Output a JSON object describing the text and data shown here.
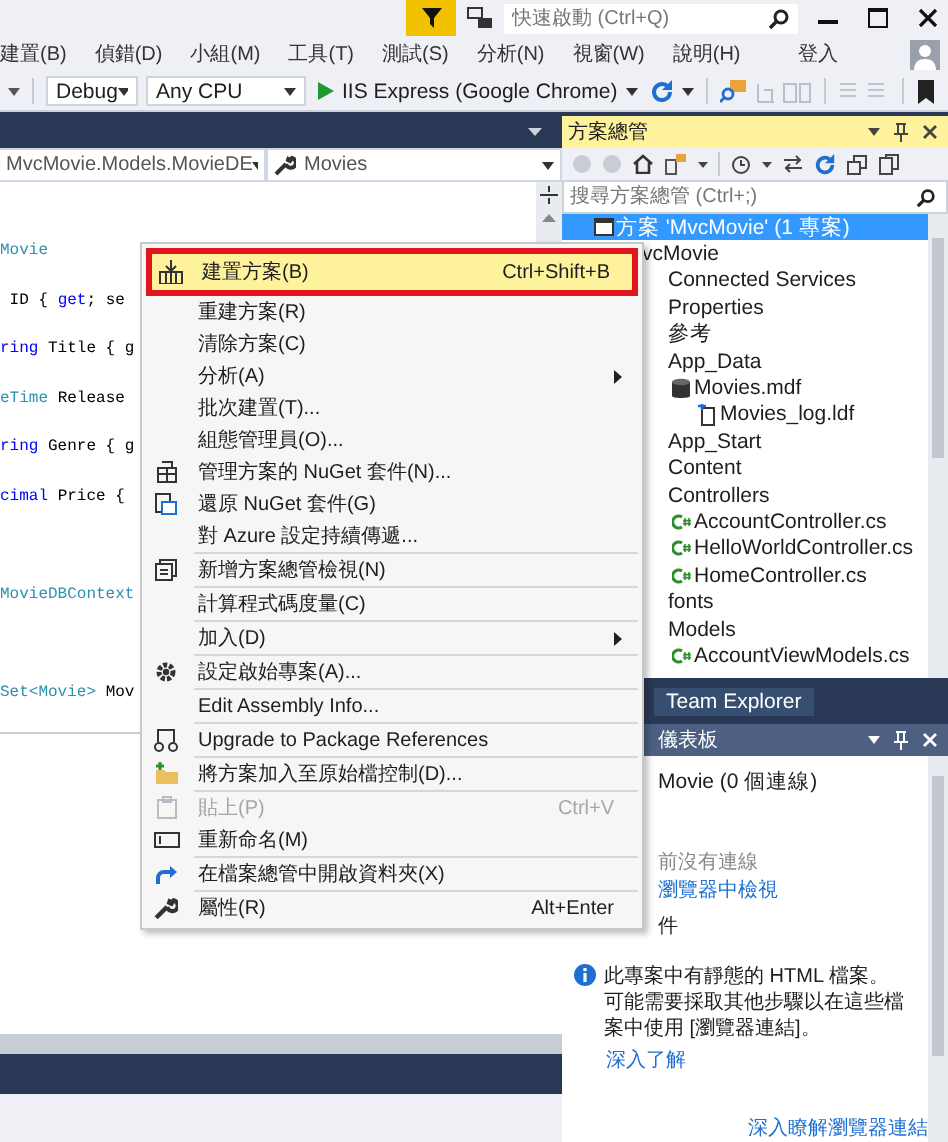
{
  "title_bar": {
    "quick_launch": {
      "placeholder": "快速啟動 (Ctrl+Q)"
    }
  },
  "menu_bar": {
    "items": [
      "建置(B)",
      "偵錯(D)",
      "小組(M)",
      "工具(T)",
      "測試(S)",
      "分析(N)",
      "視窗(W)",
      "說明(H)"
    ],
    "sign_in": "登入"
  },
  "toolbar": {
    "configuration": "Debug",
    "platform": "Any CPU",
    "run_target": "IIS Express (Google Chrome)"
  },
  "editor": {
    "type_dropdown": "MvcMovie.Models.MovieDE",
    "member_dropdown": "Movies",
    "lines": [
      {
        "gap_before": false,
        "segments": [
          {
            "text": "Movie",
            "kind": "type"
          }
        ]
      },
      {
        "gap_before": false,
        "segments": [
          {
            "text": " ID { ",
            "kind": "plain"
          },
          {
            "text": "get",
            "kind": "keyword"
          },
          {
            "text": "; se",
            "kind": "plain"
          }
        ]
      },
      {
        "gap_before": false,
        "segments": [
          {
            "text": "ring",
            "kind": "keyword"
          },
          {
            "text": " Title { g",
            "kind": "plain"
          }
        ]
      },
      {
        "gap_before": false,
        "segments": [
          {
            "text": "eTime",
            "kind": "type"
          },
          {
            "text": " Release",
            "kind": "plain"
          }
        ]
      },
      {
        "gap_before": false,
        "segments": [
          {
            "text": "ring",
            "kind": "keyword"
          },
          {
            "text": " Genre { g",
            "kind": "plain"
          }
        ]
      },
      {
        "gap_before": false,
        "segments": [
          {
            "text": "cimal",
            "kind": "keyword"
          },
          {
            "text": " Price {",
            "kind": "plain"
          }
        ]
      },
      {
        "gap_before": true,
        "segments": [
          {
            "text": "MovieDBContext",
            "kind": "type"
          }
        ]
      },
      {
        "gap_before": true,
        "segments": [
          {
            "text": "Set<",
            "kind": "type"
          },
          {
            "text": "Movie",
            "kind": "type"
          },
          {
            "text": ">",
            "kind": "type"
          },
          {
            "text": " Mov",
            "kind": "plain"
          }
        ]
      }
    ]
  },
  "solution_explorer": {
    "title": "方案總管",
    "search": {
      "placeholder": "搜尋方案總管 (Ctrl+;)"
    },
    "tree": [
      {
        "label": "方案 'MvcMovie' (1 專案)",
        "kind": "solution",
        "selected": true,
        "children": [
          {
            "label": "vcMovie",
            "selected": false,
            "children": [
              {
                "label": "Connected Services",
                "selected": false
              },
              {
                "label": "Properties",
                "selected": false
              },
              {
                "label": "參考",
                "selected": false
              },
              {
                "label": "App_Data",
                "selected": false,
                "children": [
                  {
                    "label": "Movies.mdf",
                    "kind": "database",
                    "selected": false,
                    "children": [
                      {
                        "label": "Movies_log.ldf",
                        "kind": "log",
                        "selected": false
                      }
                    ]
                  }
                ]
              },
              {
                "label": "App_Start",
                "selected": false
              },
              {
                "label": "Content",
                "selected": false
              },
              {
                "label": "Controllers",
                "selected": false,
                "children": [
                  {
                    "label": "AccountController.cs",
                    "kind": "csharp",
                    "selected": false
                  },
                  {
                    "label": "HelloWorldController.cs",
                    "kind": "csharp",
                    "selected": false
                  },
                  {
                    "label": "HomeController.cs",
                    "kind": "csharp",
                    "selected": false
                  }
                ]
              },
              {
                "label": "fonts",
                "selected": false
              },
              {
                "label": "Models",
                "selected": false,
                "children": [
                  {
                    "label": "AccountViewModels.cs",
                    "kind": "csharp",
                    "selected": false
                  }
                ]
              }
            ]
          }
        ]
      }
    ]
  },
  "team_explorer_tab": "Team Explorer",
  "browser_link_panel": {
    "title": "儀表板",
    "connection": "Movie (0 個連線)",
    "status": "前沒有連線",
    "view_link": "瀏覽器中檢視",
    "section": "件",
    "info": "此專案中有靜態的 HTML 檔案。可能需要採取其他步驟以在這些檔案中使用 [瀏覽器連結]。",
    "learn_more": "深入了解",
    "footer_link": "深入瞭解瀏覽器連結"
  },
  "context_menu": {
    "groups": [
      [
        {
          "label": "建置方案(B)",
          "shortcut": "Ctrl+Shift+B",
          "kind": "build",
          "selected": true,
          "disabled": false,
          "submenu": false
        },
        {
          "label": "重建方案(R)",
          "kind": "none",
          "selected": false,
          "disabled": false,
          "submenu": false
        },
        {
          "label": "清除方案(C)",
          "kind": "none",
          "selected": false,
          "disabled": false,
          "submenu": false
        },
        {
          "label": "分析(A)",
          "kind": "none",
          "selected": false,
          "disabled": false,
          "submenu": true
        },
        {
          "label": "批次建置(T)...",
          "kind": "none",
          "selected": false,
          "disabled": false,
          "submenu": false
        },
        {
          "label": "組態管理員(O)...",
          "kind": "none",
          "selected": false,
          "disabled": false,
          "submenu": false
        },
        {
          "label": "管理方案的 NuGet 套件(N)...",
          "kind": "nuget",
          "selected": false,
          "disabled": false,
          "submenu": false
        },
        {
          "label": "還原 NuGet 套件(G)",
          "kind": "restore",
          "selected": false,
          "disabled": false,
          "submenu": false
        },
        {
          "label": "對 Azure 設定持續傳遞...",
          "kind": "none",
          "selected": false,
          "disabled": false,
          "submenu": false
        }
      ],
      [
        {
          "label": "新增方案總管檢視(N)",
          "kind": "view",
          "selected": false,
          "disabled": false,
          "submenu": false
        }
      ],
      [
        {
          "label": "計算程式碼度量(C)",
          "kind": "none",
          "selected": false,
          "disabled": false,
          "submenu": false
        }
      ],
      [
        {
          "label": "加入(D)",
          "kind": "none",
          "selected": false,
          "disabled": false,
          "submenu": true
        }
      ],
      [
        {
          "label": "設定啟始專案(A)...",
          "kind": "gear",
          "selected": false,
          "disabled": false,
          "submenu": false
        }
      ],
      [
        {
          "label": "Edit Assembly Info...",
          "kind": "none",
          "selected": false,
          "disabled": false,
          "submenu": false
        }
      ],
      [
        {
          "label": "Upgrade to Package References",
          "kind": "upgrade",
          "selected": false,
          "disabled": false,
          "submenu": false
        }
      ],
      [
        {
          "label": "將方案加入至原始檔控制(D)...",
          "kind": "vcs",
          "selected": false,
          "disabled": false,
          "submenu": false
        }
      ],
      [
        {
          "label": "貼上(P)",
          "shortcut": "Ctrl+V",
          "kind": "paste",
          "selected": false,
          "disabled": true,
          "submenu": false
        },
        {
          "label": "重新命名(M)",
          "kind": "rename",
          "selected": false,
          "disabled": false,
          "submenu": false
        }
      ],
      [
        {
          "label": "在檔案總管中開啟資料夾(X)",
          "kind": "folder",
          "selected": false,
          "disabled": false,
          "submenu": false
        }
      ],
      [
        {
          "label": "屬性(R)",
          "shortcut": "Alt+Enter",
          "kind": "wrench",
          "selected": false,
          "disabled": false,
          "submenu": false
        }
      ]
    ]
  }
}
